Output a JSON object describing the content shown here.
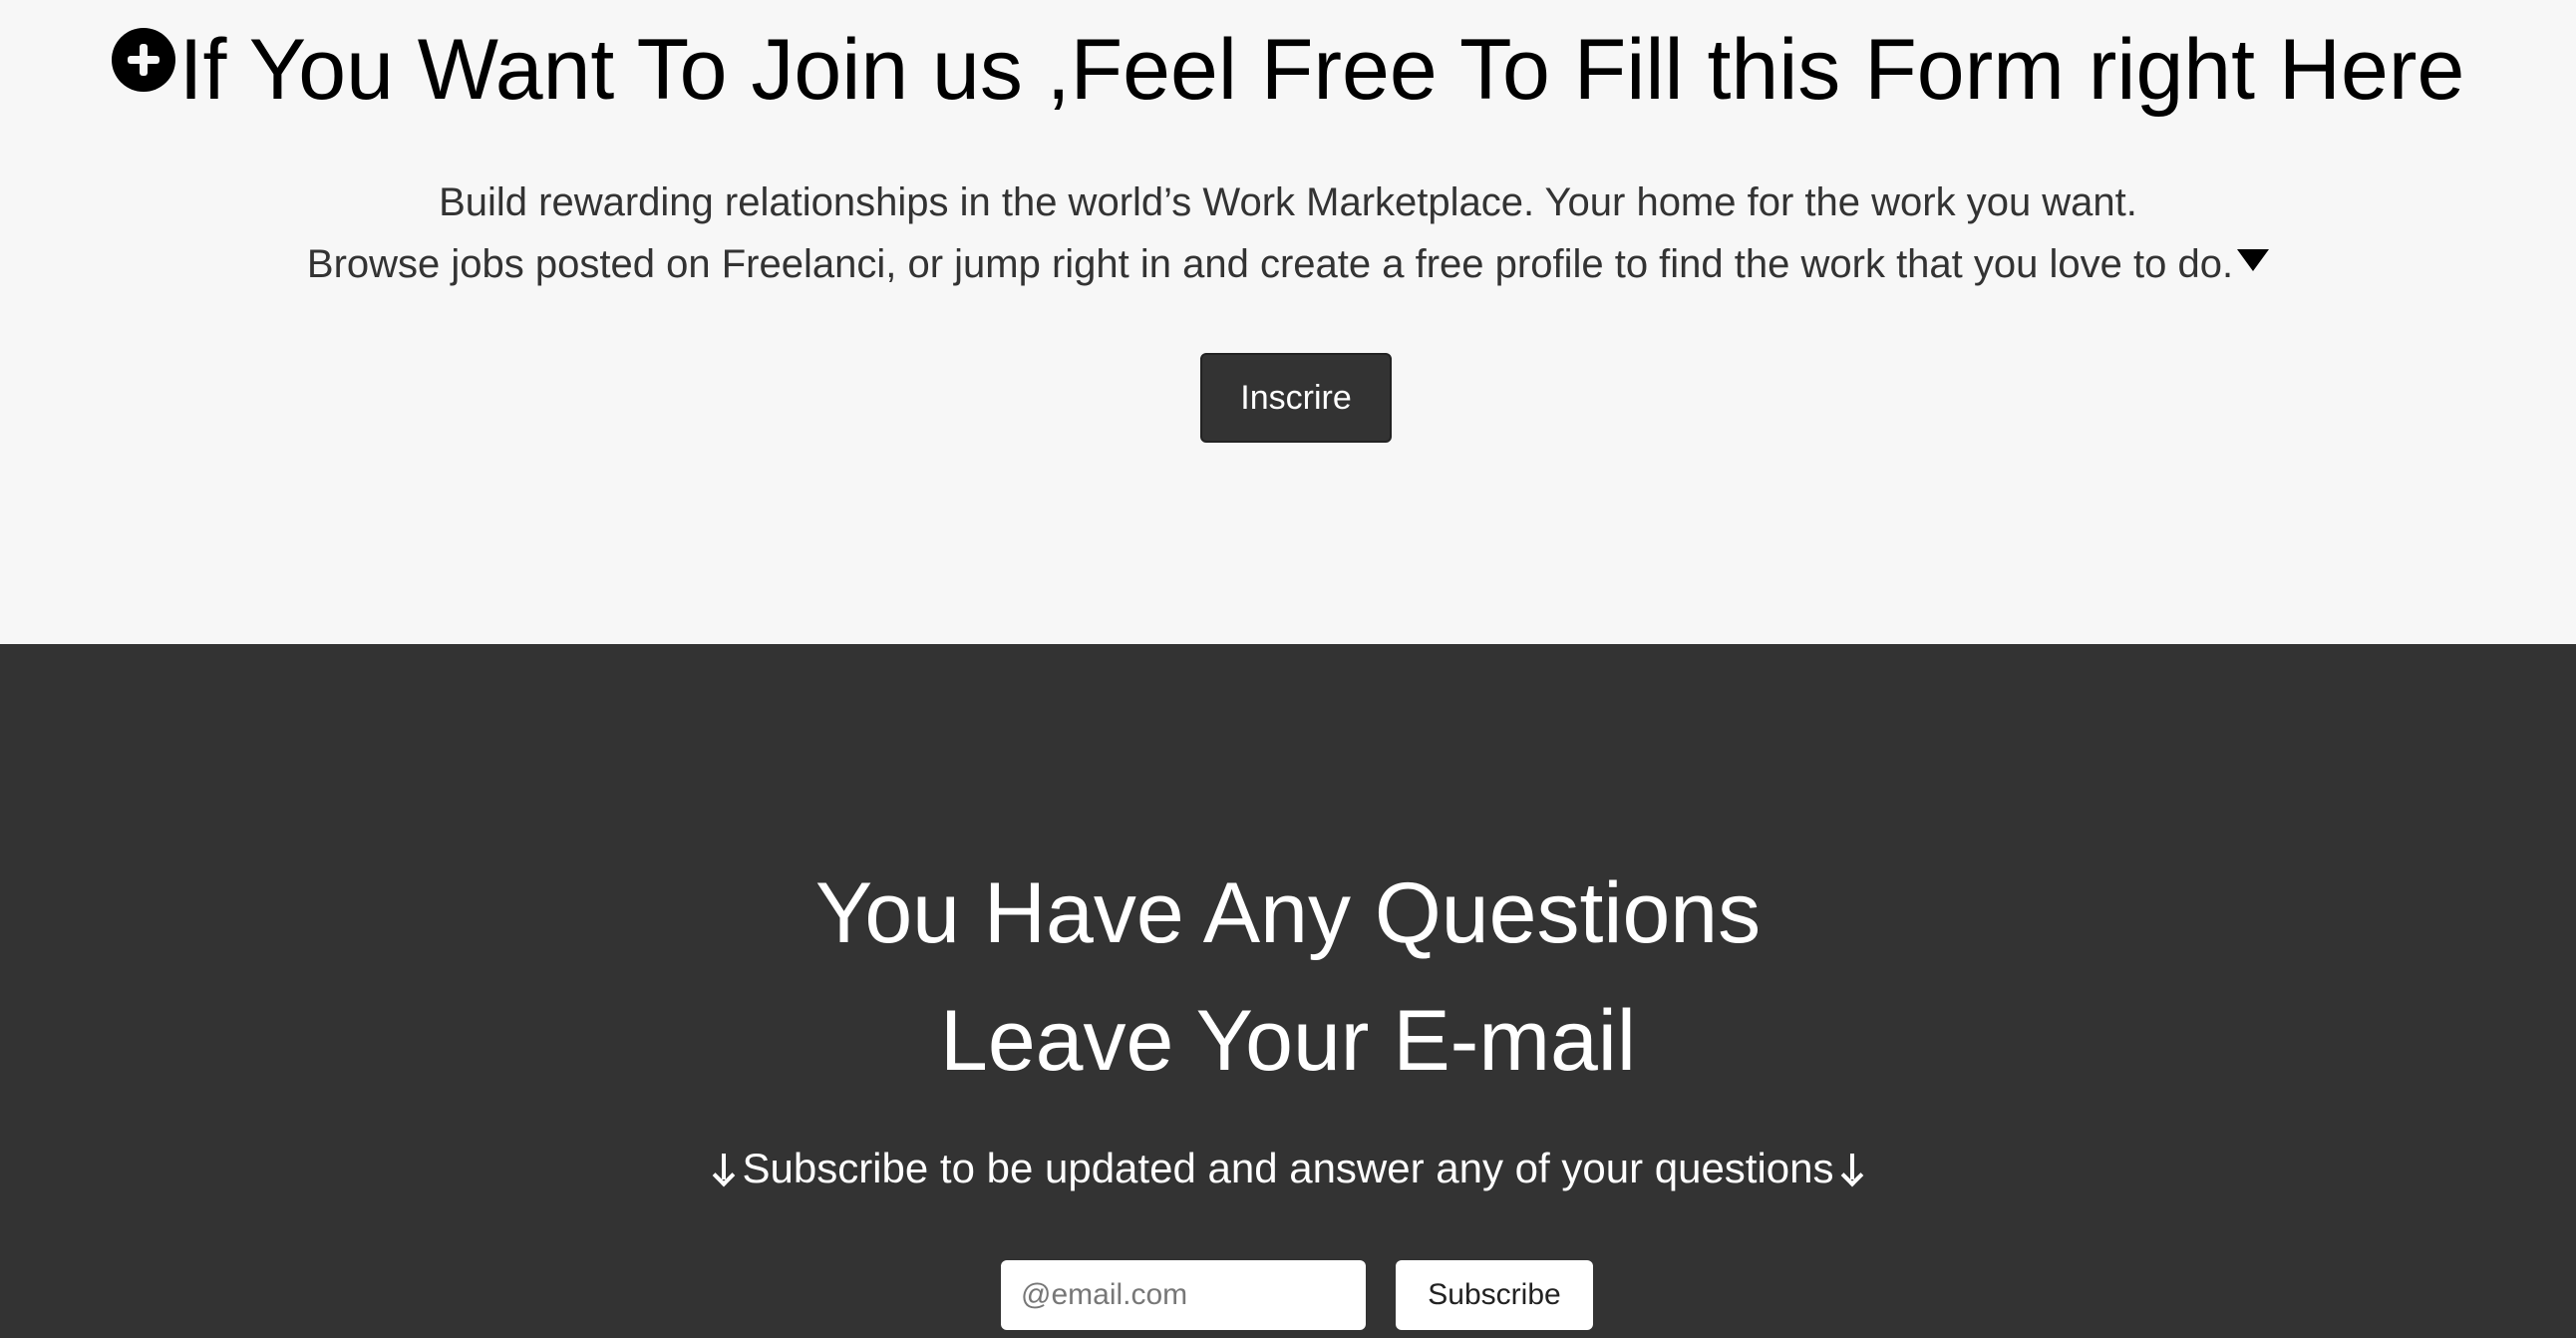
{
  "join": {
    "title": "If You Want To Join us ,Feel Free To Fill this Form right Here",
    "description_line1": "Build rewarding relationships in the world’s Work Marketplace. Your home for the work you want.",
    "description_line2": "Browse jobs posted on Freelanci, or jump right in and create a free profile to find the work that you love to do.",
    "button_label": "Inscrire",
    "icons": [
      "plus-circle-icon",
      "caret-down-icon"
    ]
  },
  "contact": {
    "heading_line1": "You Have Any Questions",
    "heading_line2": "Leave Your E-mail",
    "subscribe_note": "Subscribe to be updated and answer any of your questions",
    "email_placeholder": "@email.com",
    "email_value": "",
    "subscribe_label": "Subscribe",
    "icons": [
      "arrow-down-icon",
      "arrow-down-icon"
    ]
  },
  "colors": {
    "light_background": "#f7f7f7",
    "dark_background": "#333333",
    "button_dark": "#333333",
    "text_light": "#ffffff",
    "text_dark": "#000000"
  }
}
